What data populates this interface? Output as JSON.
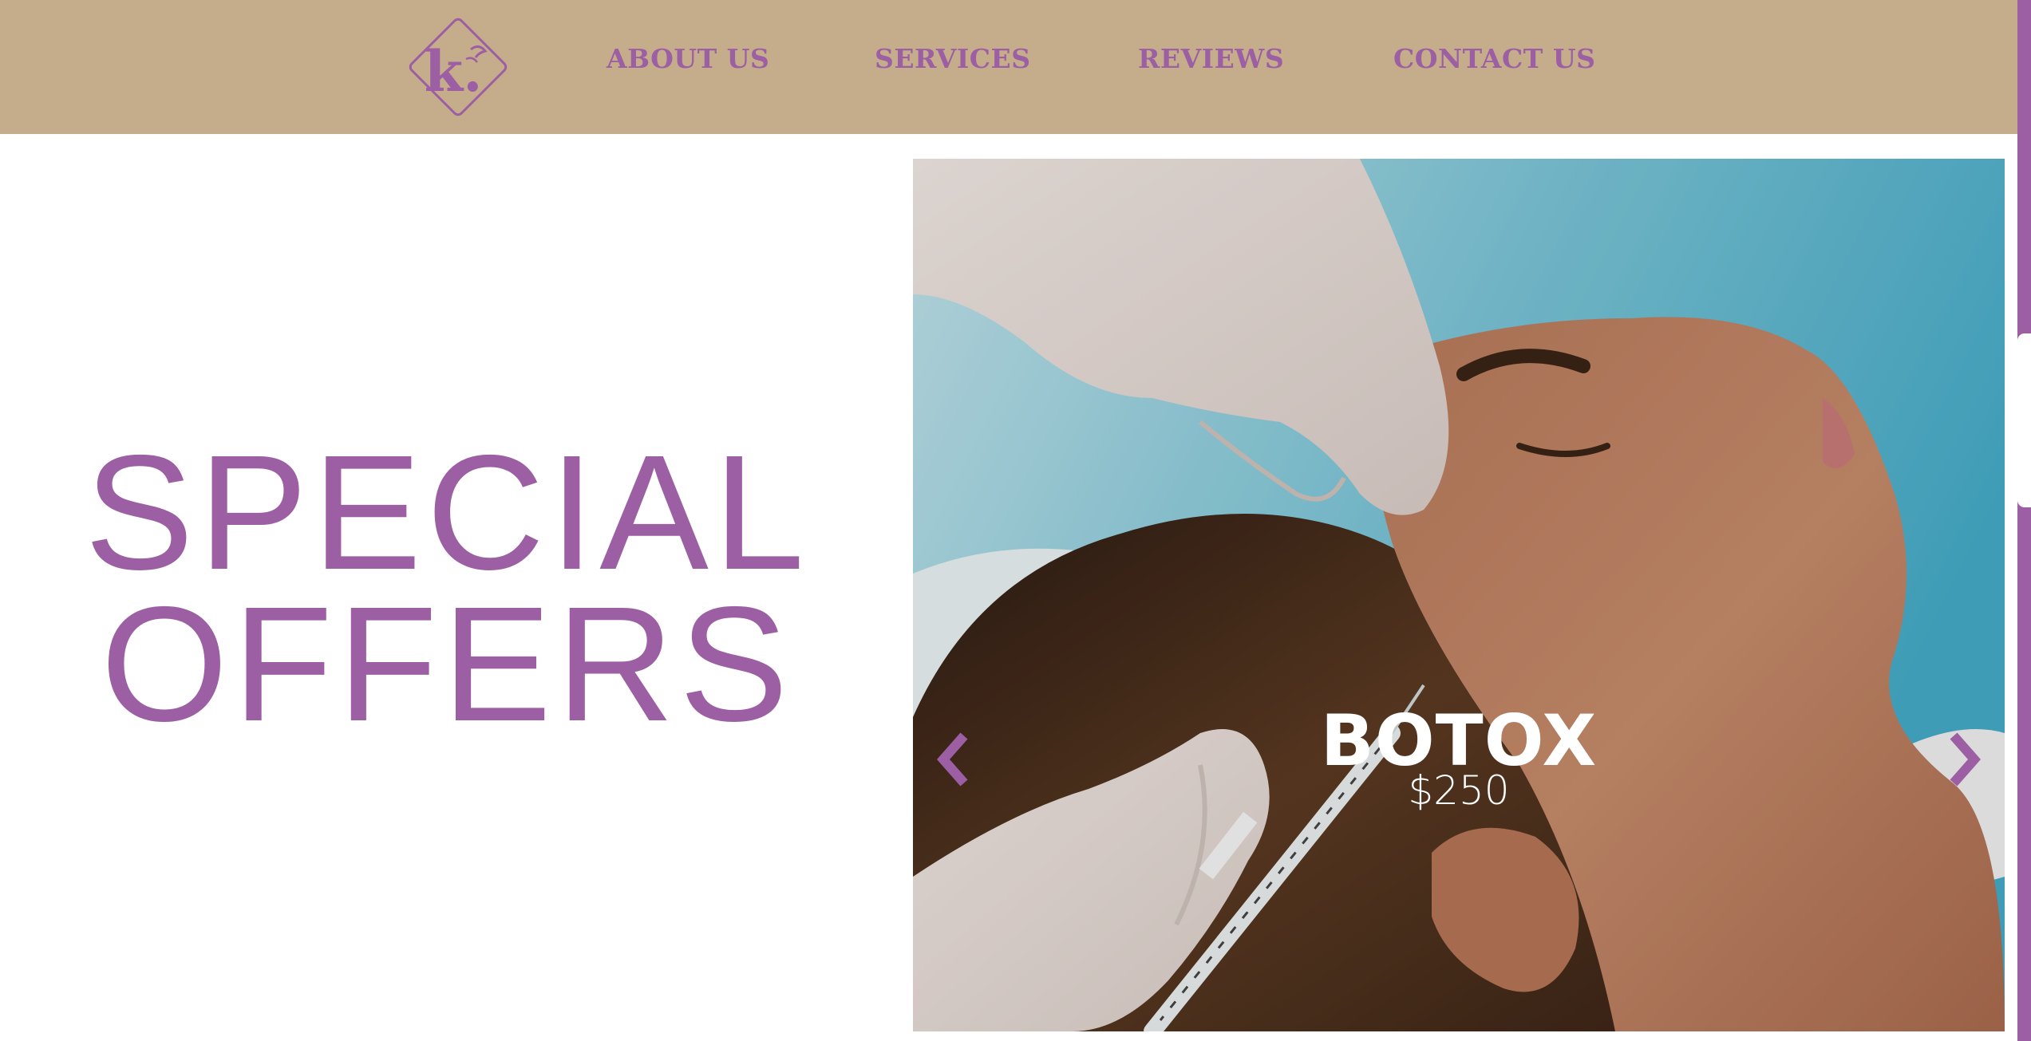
{
  "header": {
    "logo_letter": "k.",
    "nav": [
      {
        "label": "ABOUT US"
      },
      {
        "label": "SERVICES"
      },
      {
        "label": "REVIEWS"
      },
      {
        "label": "CONTACT US"
      }
    ]
  },
  "hero": {
    "headline_line1": "SPECIAL",
    "headline_line2": "OFFERS"
  },
  "carousel": {
    "slide_title": "BOTOX",
    "slide_price": "$250",
    "prev_icon": "chevron-left-icon",
    "next_icon": "chevron-right-icon"
  },
  "colors": {
    "header_bg": "#c5ad8b",
    "accent": "#9c5fa4",
    "text_on_image": "#ffffff"
  }
}
